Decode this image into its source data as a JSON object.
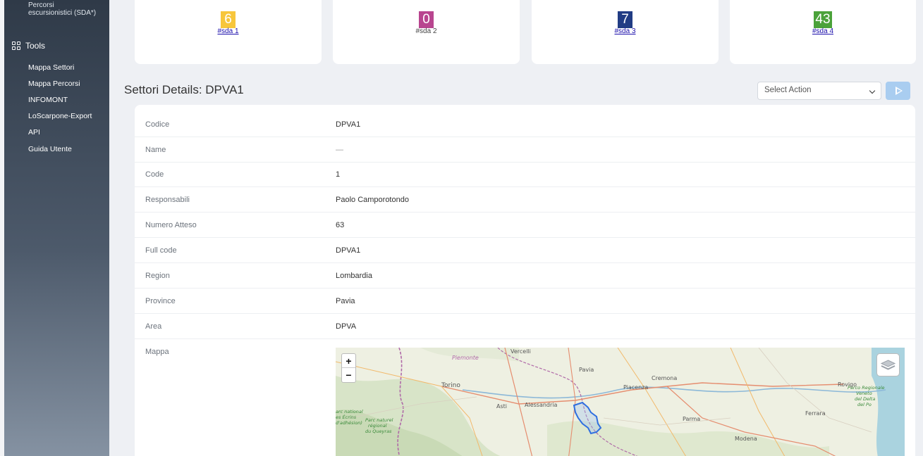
{
  "sidebar": {
    "top_item": "Percorsi escursionistici (SDA*)",
    "top_item_line1": "Percorsi",
    "top_item_line2": "escursionistici (SDA*)",
    "section_label": "Tools",
    "items": [
      {
        "label": "Mappa Settori"
      },
      {
        "label": "Mappa Percorsi"
      },
      {
        "label": "INFOMONT"
      },
      {
        "label": "LoScarpone-Export"
      },
      {
        "label": "API"
      },
      {
        "label": "Guida Utente"
      }
    ]
  },
  "stats": [
    {
      "value": "6",
      "link": "#sda 1",
      "color": "#f7c63c"
    },
    {
      "value": "0",
      "link": "#sda 2",
      "color": "#b8458f"
    },
    {
      "value": "7",
      "link": "#sda 3",
      "color": "#213c84"
    },
    {
      "value": "43",
      "link": "#sda 4",
      "color": "#4ba23a"
    }
  ],
  "details": {
    "title": "Settori Details: DPVA1",
    "select_placeholder": "Select Action",
    "rows": [
      {
        "label": "Codice",
        "value": "DPVA1"
      },
      {
        "label": "Name",
        "value": "—"
      },
      {
        "label": "Code",
        "value": "1"
      },
      {
        "label": "Responsabili",
        "value": "Paolo Camporotondo"
      },
      {
        "label": "Numero Atteso",
        "value": "63"
      },
      {
        "label": "Full code",
        "value": "DPVA1"
      },
      {
        "label": "Region",
        "value": "Lombardia"
      },
      {
        "label": "Province",
        "value": "Pavia"
      },
      {
        "label": "Area",
        "value": "DPVA"
      },
      {
        "label": "Mappa",
        "value": ""
      }
    ]
  },
  "map": {
    "zoom_in": "+",
    "zoom_out": "−",
    "labels": {
      "vercelli": "Vercelli",
      "piemonte": "Piemonte",
      "torino": "Torino",
      "pavia": "Pavia",
      "cremona": "Cremona",
      "piacenza": "Piacenza",
      "asti": "Asti",
      "alessandria": "Alessandria",
      "parma": "Parma",
      "rovigo": "Rovigo",
      "ferrara": "Ferrara",
      "modena": "Modena",
      "parc_ecrins_1": "arc national",
      "parc_ecrins_2": "es Écrins",
      "parc_ecrins_3": "d'adhésion)",
      "parc_queyras_1": "Parc naturel",
      "parc_queyras_2": "régional",
      "parc_queyras_3": "du Queyras",
      "parco_delta_1": "Parco Regionale",
      "parco_delta_2": "Veneto",
      "parco_delta_3": "del Delta",
      "parco_delta_4": "del Po"
    },
    "colors": {
      "sector_outline": "#2f6fe0",
      "sector_fill": "#9bbff2"
    }
  }
}
